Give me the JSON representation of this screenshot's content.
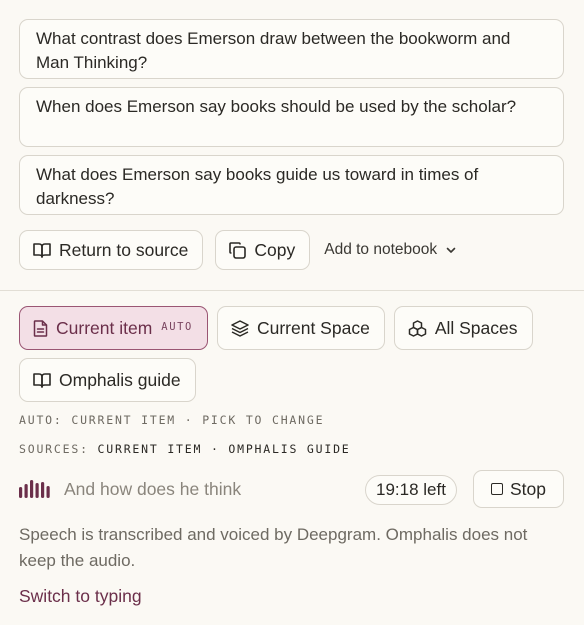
{
  "suggestions": [
    "What contrast does Emerson draw between the bookworm and Man Thinking?",
    "When does Emerson say books should be used by the scholar?",
    "What does Emerson say books guide us toward in times of darkness?"
  ],
  "actions": {
    "return_label": "Return to source",
    "copy_label": "Copy",
    "notebook_label": "Add to notebook"
  },
  "scopes": {
    "current_item": "Current item",
    "auto_tag": "AUTO",
    "current_space": "Current Space",
    "all_spaces": "All Spaces",
    "guide": "Omphalis guide"
  },
  "scope_status": "AUTO: CURRENT ITEM · PICK TO CHANGE",
  "sources": {
    "label": "SOURCES:",
    "value": "CURRENT ITEM · OMPHALIS GUIDE"
  },
  "voice": {
    "transcript": "And how does he think",
    "time_left": "19:18 left",
    "stop_label": "Stop"
  },
  "note": "Speech is transcribed and voiced by Deepgram. Omphalis does not keep the audio.",
  "switch_label": "Switch to typing",
  "colors": {
    "accent": "#6b2f4a",
    "accent_bg": "#f3dfe6",
    "background": "#fbf9f4",
    "border": "#d9d5cc"
  }
}
